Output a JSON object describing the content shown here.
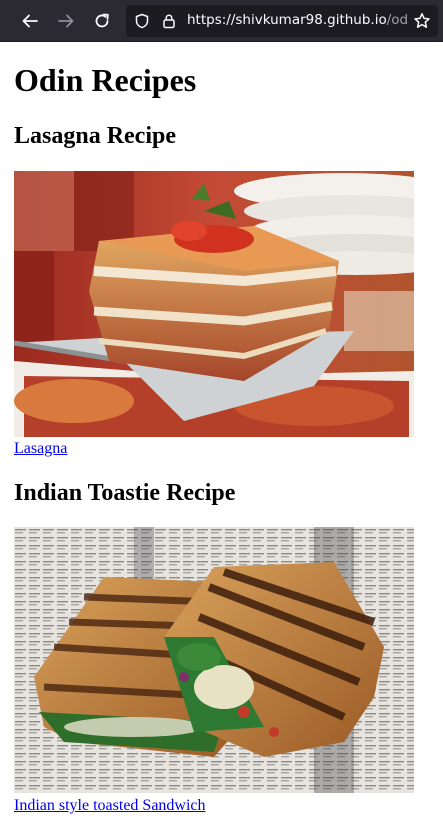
{
  "browser": {
    "url_main": "https://shivkumar98.github.io",
    "url_rest": "/odin",
    "back_icon": "arrow-left-icon",
    "forward_icon": "arrow-right-icon",
    "reload_icon": "reload-icon",
    "shield_icon": "shield-icon",
    "lock_icon": "lock-icon",
    "bookmark_icon": "star-icon"
  },
  "page": {
    "title": "Odin Recipes",
    "recipes": [
      {
        "heading": "Lasagna Recipe",
        "link_text": "Lasagna",
        "image": "lasagna-photo"
      },
      {
        "heading": "Indian Toastie Recipe",
        "link_text": "Indian style toasted Sandwich",
        "image": "toastie-photo"
      }
    ]
  },
  "colors": {
    "toolbar_bg": "#2b2a33",
    "urlbar_bg": "#1c1b22",
    "link": "#0000ee"
  }
}
